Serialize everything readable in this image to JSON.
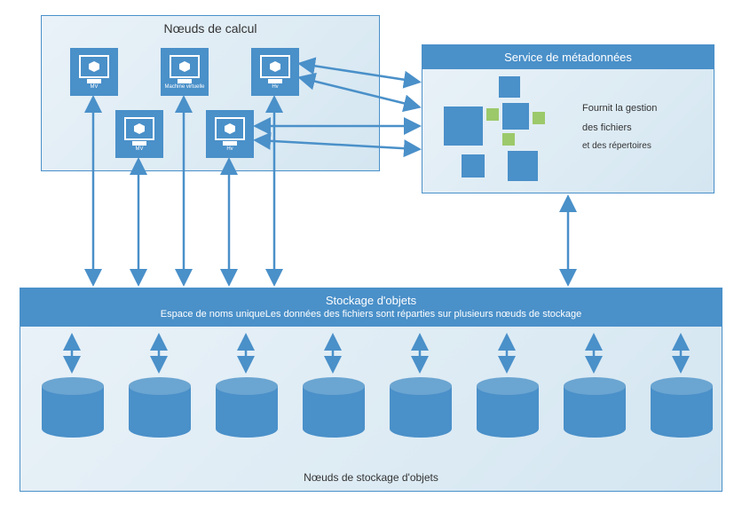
{
  "compute": {
    "title": "Nœuds de calcul",
    "nodes": [
      {
        "label": "MV"
      },
      {
        "label": "Machine virtuelle"
      },
      {
        "label": "Hv"
      },
      {
        "label": "MV"
      },
      {
        "label": "Hv"
      }
    ]
  },
  "metadata": {
    "title": "Service de métadonnées",
    "line1": "Fournit la gestion",
    "line2": "des fichiers",
    "line3": "et des répertoires"
  },
  "storage": {
    "title": "Stockage d'objets",
    "subtitle": "Espace de noms uniqueLes données des fichiers sont réparties sur plusieurs nœuds de stockage",
    "footer": "Nœuds de stockage d'objets",
    "node_count": 8
  }
}
